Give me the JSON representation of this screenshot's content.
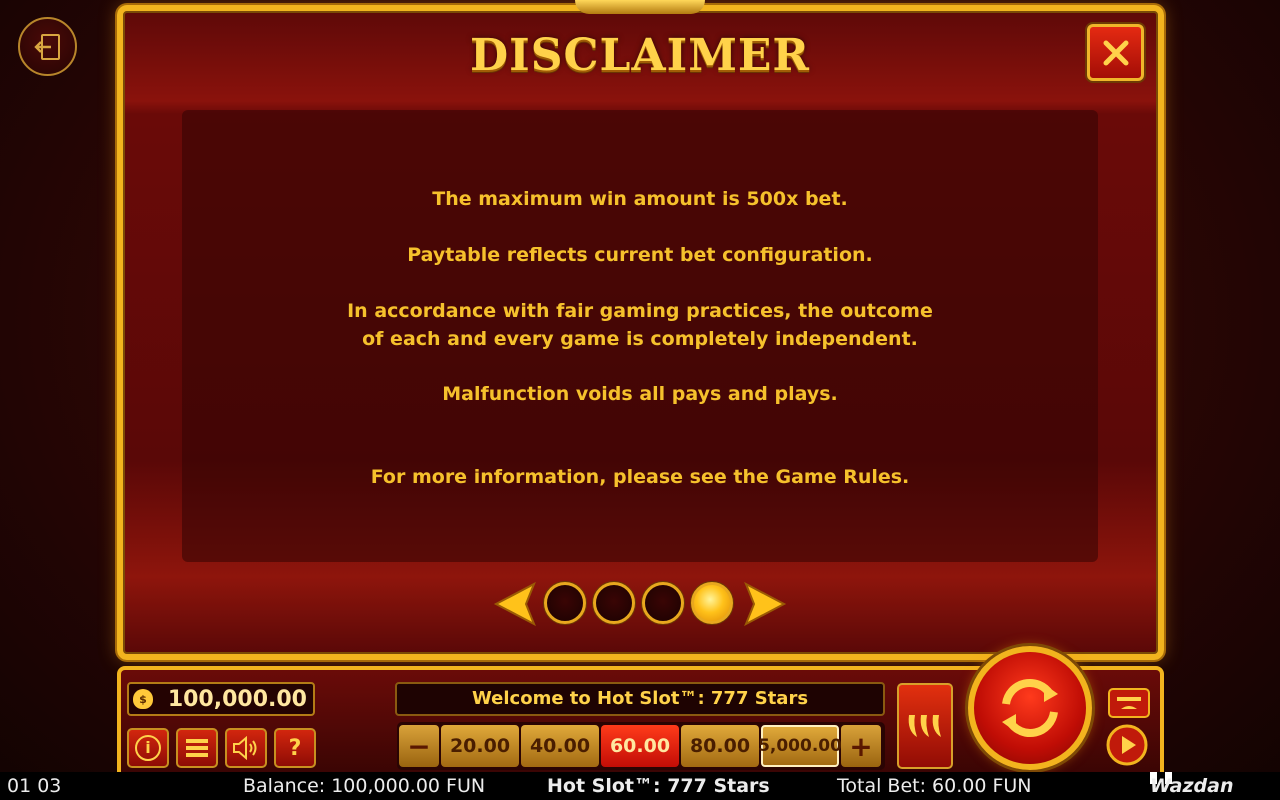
{
  "dialog": {
    "title": "DISCLAIMER",
    "lines": [
      "The maximum win amount is 500x bet.",
      "Paytable reflects current bet configuration.",
      "In accordance with fair gaming practices, the outcome",
      "of each and every game is completely independent.",
      "Malfunction voids all pays and plays.",
      "For more information, please see the Game Rules."
    ],
    "pager": {
      "total_pages": 4,
      "current_page": 4
    }
  },
  "controls": {
    "balance_value": "100,000.00",
    "welcome_text": "Welcome to Hot Slot™: 777 Stars",
    "minus_label": "−",
    "plus_label": "+",
    "bets": [
      "20.00",
      "40.00",
      "60.00",
      "80.00",
      "5,000.00"
    ],
    "selected_bet": "60.00",
    "info_label": "i",
    "help_label": "?"
  },
  "status_bar": {
    "time": "01 03",
    "balance": "Balance: 100,000.00 FUN",
    "game_name": "Hot Slot™: 777 Stars",
    "total_bet": "Total Bet: 60.00 FUN",
    "brand": "Wazdan"
  },
  "icons": {
    "exit": "exit-icon",
    "close": "close-icon",
    "prev": "arrow-left-icon",
    "next": "arrow-right-icon",
    "menu": "menu-icon",
    "sound": "speaker-icon",
    "chili": "chili-icon",
    "spin": "spin-icon"
  },
  "colors": {
    "gold": "#f2b41e",
    "text_yellow": "#f6c12c",
    "panel_red": "#6a0a08",
    "selected_bet_red": "#e0240e"
  }
}
